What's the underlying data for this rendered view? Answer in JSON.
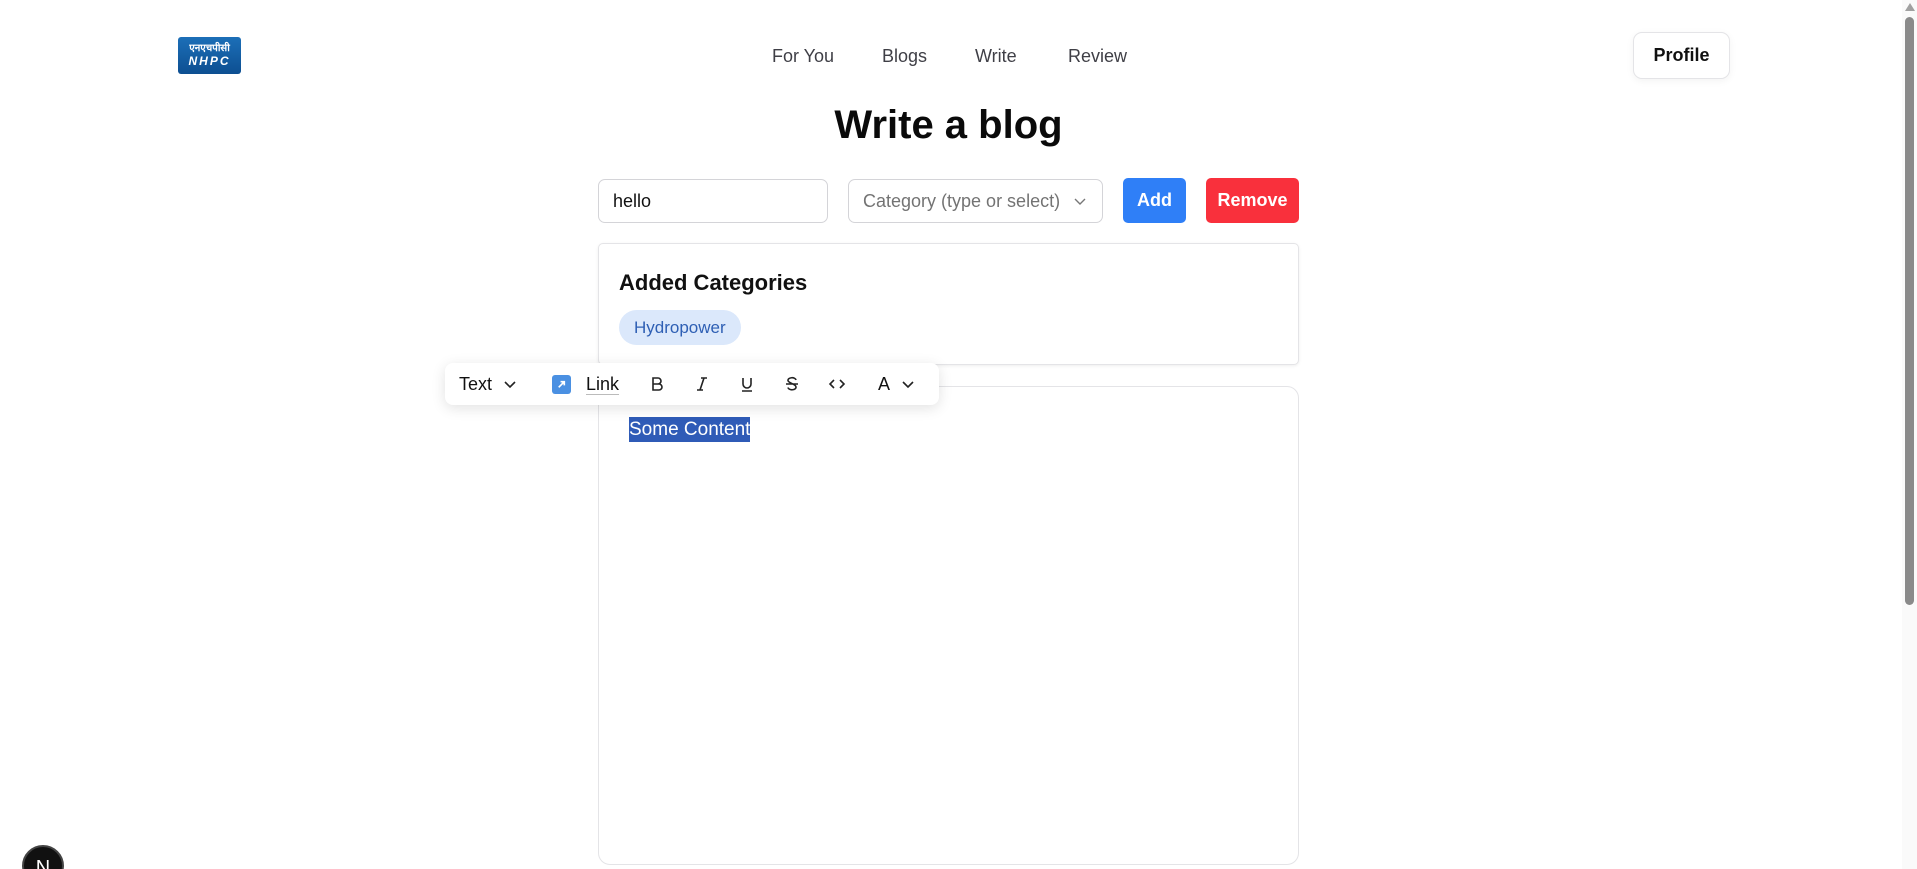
{
  "header": {
    "logo_hindi": "एनएचपीसी",
    "logo_text": "NHPC",
    "nav": [
      "For You",
      "Blogs",
      "Write",
      "Review"
    ],
    "profile_label": "Profile"
  },
  "main": {
    "title": "Write a blog",
    "input_value": "hello",
    "category_placeholder": "Category (type or select)",
    "add_label": "Add",
    "remove_label": "Remove"
  },
  "categories": {
    "heading": "Added Categories",
    "items": [
      "Hydropower"
    ]
  },
  "toolbar": {
    "block_type": "Text",
    "link_label": "Link",
    "color_label": "A",
    "icons": [
      "chevron-down-icon",
      "link-icon",
      "bold-icon",
      "italic-icon",
      "underline-icon",
      "strikethrough-icon",
      "code-icon",
      "text-color-icon"
    ]
  },
  "editor": {
    "content": "Some Content"
  },
  "dev_badge": "N",
  "colors": {
    "add_button": "#2f7ff7",
    "remove_button": "#f9303c",
    "chip_bg": "#dbe8fb",
    "chip_text": "#2e5fb4",
    "selection": "#2f5bb7"
  }
}
